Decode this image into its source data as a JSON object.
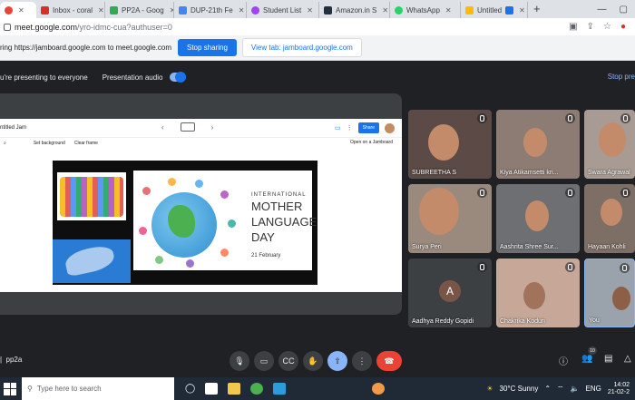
{
  "browser": {
    "tabs": [
      {
        "label": "",
        "color": "#ea4335",
        "active": true
      },
      {
        "label": "Inbox - coral",
        "color": "#d93025",
        "active": false
      },
      {
        "label": "PP2A - Goog",
        "color": "#34a853",
        "active": false
      },
      {
        "label": "DUP-21th Fe",
        "color": "#4285f4",
        "active": false
      },
      {
        "label": "Student List",
        "color": "#a142f4",
        "active": false
      },
      {
        "label": "Amazon.in S",
        "color": "#232f3e",
        "active": false
      },
      {
        "label": "WhatsApp",
        "color": "#25d366",
        "active": false
      },
      {
        "label": "Untitled",
        "color": "#fbbc04",
        "active": false
      }
    ],
    "new_tab": "+",
    "address": {
      "host": "meet.google.com",
      "path": "/yro-idmc-cua?authuser=0"
    }
  },
  "sharing_bar": {
    "message": "ring https://jamboard.google.com to meet.google.com",
    "stop_label": "Stop sharing",
    "view_label": "View tab: jamboard.google.com"
  },
  "presentation": {
    "status": "u're presenting to everyone",
    "audio_label": "Presentation audio",
    "stop_label": "Stop pre"
  },
  "jamboard": {
    "title": "ntitled Jam",
    "set_background": "Set background",
    "clear_frame": "Clear frame",
    "share_label": "Share",
    "open_label": "Open on a Jamboard",
    "poster": {
      "line1": "INTERNATIONAL",
      "line2": "MOTHER",
      "line3": "LANGUAGE",
      "line4": "DAY",
      "date": "21 February"
    }
  },
  "participants": [
    {
      "name": "SUBREETHA S",
      "bg": "#5b4a45"
    },
    {
      "name": "Kiya Atikamsetti kri...",
      "bg": "#8d7c73"
    },
    {
      "name": "Swara Agrawal",
      "bg": "#a79b93"
    },
    {
      "name": "Surya Peri",
      "bg": "#9a8a7e"
    },
    {
      "name": "Aashrita Shree Sur...",
      "bg": "#6e6f73"
    },
    {
      "name": "Hayaan Kohli",
      "bg": "#7d6f66"
    },
    {
      "name": "Aadhya Reddy Gopidi",
      "bg": "#3c4043",
      "initial": "A"
    },
    {
      "name": "Chakrika Koduri",
      "bg": "#c7a798"
    },
    {
      "name": "You",
      "bg": "#9aa3ab"
    }
  ],
  "meeting": {
    "code": "pp2a",
    "participant_count": "10"
  },
  "taskbar": {
    "search_placeholder": "Type here to search",
    "weather": "30°C  Sunny",
    "lang": "ENG",
    "time": "14:02",
    "date": "21-02-2"
  }
}
